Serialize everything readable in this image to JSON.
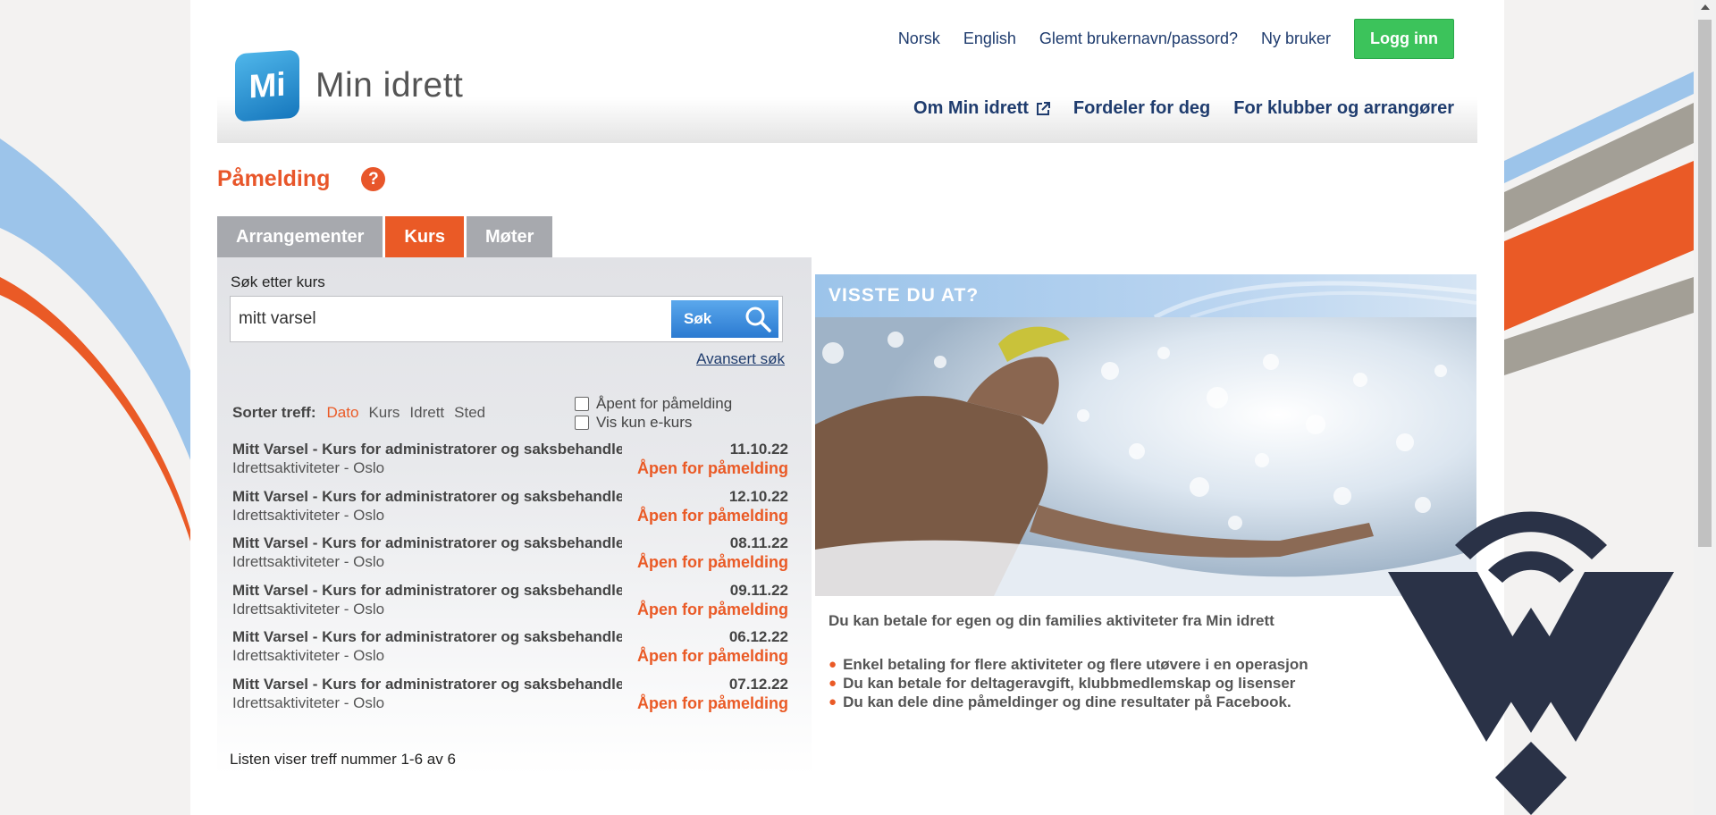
{
  "header": {
    "logo_badge": "Mi",
    "logo_text": "Min idrett",
    "top_links": [
      "Norsk",
      "English",
      "Glemt brukernavn/passord?",
      "Ny bruker"
    ],
    "login_label": "Logg inn",
    "main_nav": [
      "Om Min idrett",
      "Fordeler for deg",
      "For klubber og arrangører"
    ]
  },
  "page": {
    "title": "Påmelding",
    "help": "?"
  },
  "tabs": [
    {
      "label": "Arrangementer",
      "active": false
    },
    {
      "label": "Kurs",
      "active": true
    },
    {
      "label": "Møter",
      "active": false
    }
  ],
  "search": {
    "label": "Søk etter kurs",
    "value": "mitt varsel",
    "button_label": "Søk",
    "advanced_link": "Avansert søk"
  },
  "sort": {
    "label": "Sorter treff:",
    "options": [
      "Dato",
      "Kurs",
      "Idrett",
      "Sted"
    ],
    "active": "Dato"
  },
  "filters": [
    {
      "label": "Åpent for påmelding",
      "checked": false
    },
    {
      "label": "Vis kun e-kurs",
      "checked": false
    }
  ],
  "results": [
    {
      "title": "Mitt Varsel - Kurs for administratorer og saksbehandlere",
      "date": "11.10.22",
      "subtitle": "Idrettsaktiviteter - Oslo",
      "status": "Åpen for påmelding"
    },
    {
      "title": "Mitt Varsel - Kurs for administratorer og saksbehandlere",
      "date": "12.10.22",
      "subtitle": "Idrettsaktiviteter - Oslo",
      "status": "Åpen for påmelding"
    },
    {
      "title": "Mitt Varsel - Kurs for administratorer og saksbehandlere",
      "date": "08.11.22",
      "subtitle": "Idrettsaktiviteter - Oslo",
      "status": "Åpen for påmelding"
    },
    {
      "title": "Mitt Varsel - Kurs for administratorer og saksbehandlere",
      "date": "09.11.22",
      "subtitle": "Idrettsaktiviteter - Oslo",
      "status": "Åpen for påmelding"
    },
    {
      "title": "Mitt Varsel - Kurs for administratorer og saksbehandlere",
      "date": "06.12.22",
      "subtitle": "Idrettsaktiviteter - Oslo",
      "status": "Åpen for påmelding"
    },
    {
      "title": "Mitt Varsel - Kurs for administratorer og saksbehandlere",
      "date": "07.12.22",
      "subtitle": "Idrettsaktiviteter - Oslo",
      "status": "Åpen for påmelding"
    }
  ],
  "result_count": "Listen viser treff nummer 1-6 av 6",
  "info": {
    "header": "VISSTE DU AT?",
    "lead": "Du kan betale for egen og din families aktiviteter fra Min idrett",
    "bullets": [
      "Enkel betaling for flere aktiviteter og flere utøvere i en operasjon",
      "Du kan betale for deltageravgift, klubbmedlemskap og lisenser",
      "Du kan dele dine påmeldinger og dine resultater på Facebook."
    ]
  },
  "colors": {
    "accent_orange": "#ea5a26",
    "nav_blue": "#1f3c6e",
    "login_green": "#3cc35b",
    "info_blue": "#9cc4ea",
    "watermark_navy": "#2a3247"
  },
  "icons": {
    "external_link": "external-link-icon",
    "search": "magnifier-icon",
    "help": "question-mark-icon",
    "watermark": "wifi-diamond-logo"
  }
}
